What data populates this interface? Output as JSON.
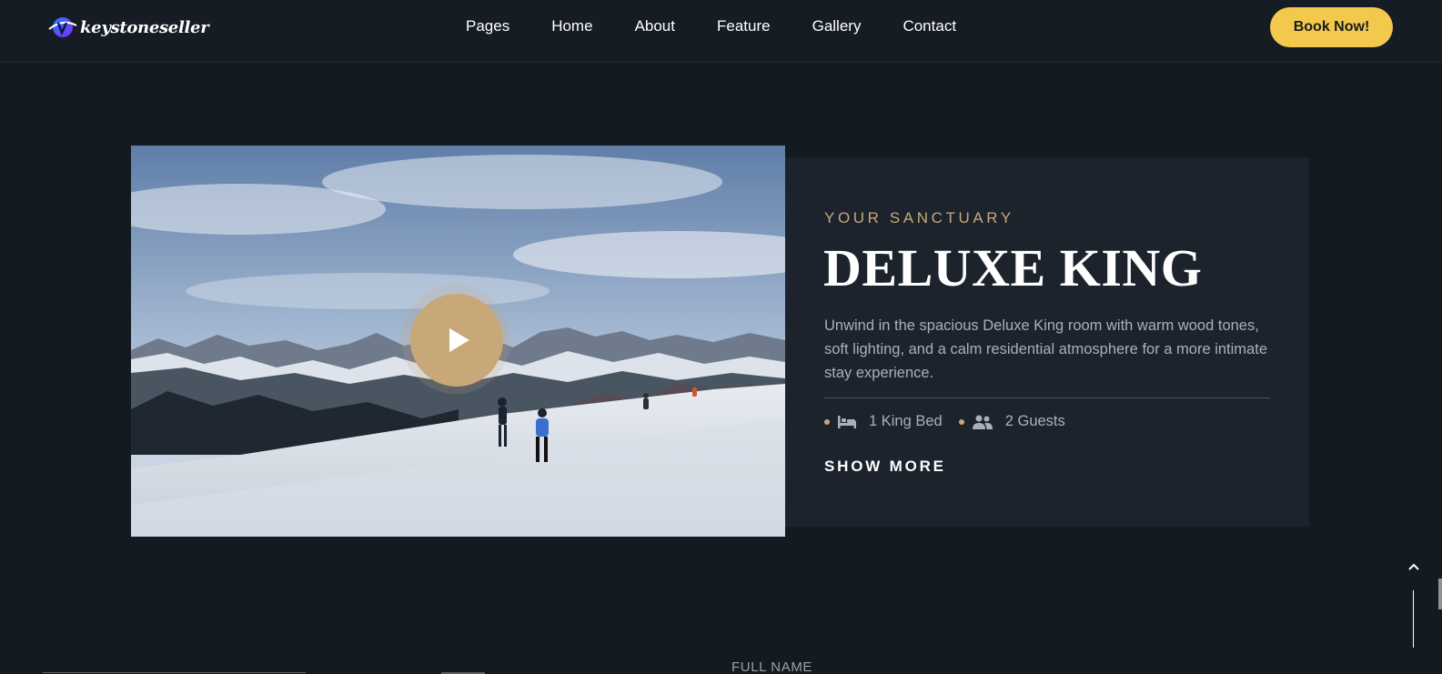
{
  "brand": {
    "name": "keystoneseller"
  },
  "nav": {
    "items": [
      {
        "label": "Pages"
      },
      {
        "label": "Home"
      },
      {
        "label": "About"
      },
      {
        "label": "Feature"
      },
      {
        "label": "Gallery"
      },
      {
        "label": "Contact"
      }
    ],
    "cta_label": "Book Now!"
  },
  "room": {
    "eyebrow": "YOUR SANCTUARY",
    "title": "DELUXE KING",
    "description": "Unwind in the spacious Deluxe King room with warm wood tones, soft lighting, and a calm residential atmosphere for a more intimate stay experience.",
    "amenities": [
      {
        "icon": "bed-icon",
        "label": "1 King Bed"
      },
      {
        "icon": "guests-icon",
        "label": "2 Guests"
      }
    ],
    "show_more_label": "SHOW MORE",
    "media": {
      "type": "video",
      "scene": "skiers on snowy mountain slope",
      "play_icon": "play-icon"
    }
  },
  "form": {
    "field_label": "FULL NAME"
  },
  "colors": {
    "background": "#131a22",
    "card": "#1c232d",
    "accent_gold": "#c8a878",
    "cta_yellow": "#f2c94c",
    "text_muted": "#a9b0ba"
  },
  "icons": {
    "scroll_top": "chevron-up-icon"
  }
}
